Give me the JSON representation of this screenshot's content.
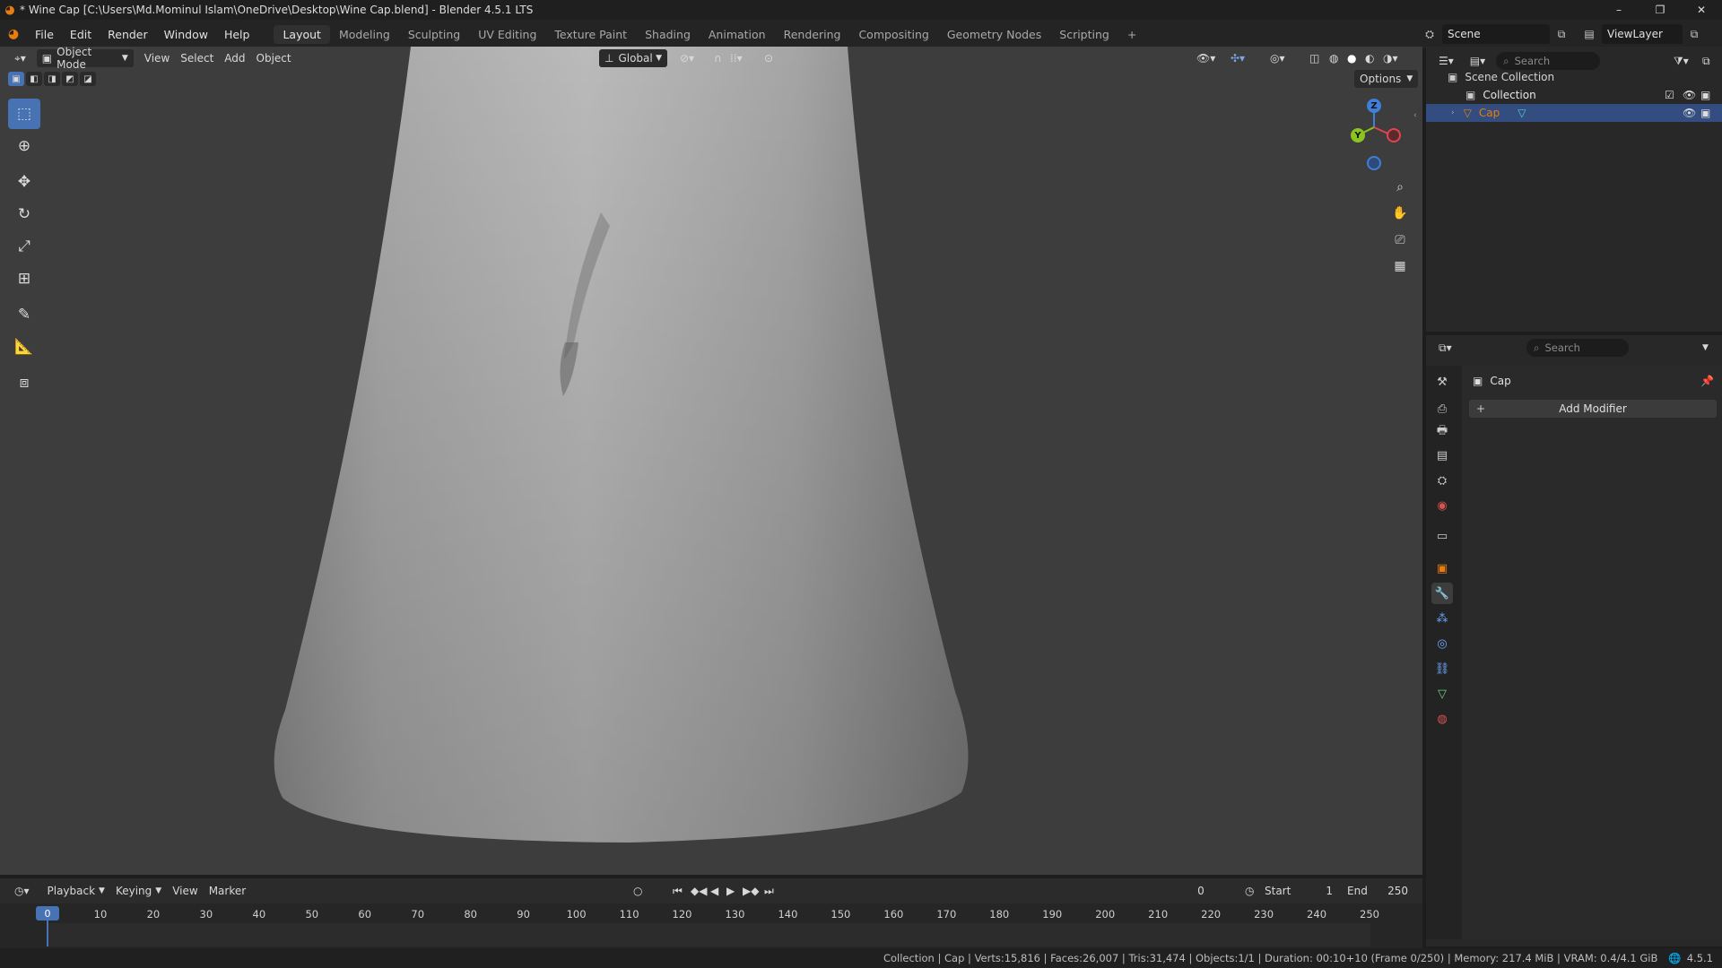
{
  "window": {
    "title": "* Wine Cap [C:\\Users\\Md.Mominul Islam\\OneDrive\\Desktop\\Wine Cap.blend] - Blender 4.5.1 LTS",
    "minimize": "–",
    "maximize": "❐",
    "close": "✕"
  },
  "menu": {
    "items": [
      "File",
      "Edit",
      "Render",
      "Window",
      "Help"
    ],
    "workspaces": [
      "Layout",
      "Modeling",
      "Sculpting",
      "UV Editing",
      "Texture Paint",
      "Shading",
      "Animation",
      "Rendering",
      "Compositing",
      "Geometry Nodes",
      "Scripting"
    ],
    "active_workspace": "Layout",
    "add_workspace": "+",
    "scene": "Scene",
    "view_layer": "ViewLayer"
  },
  "viewport": {
    "mode": "Object Mode",
    "menus": [
      "View",
      "Select",
      "Add",
      "Object"
    ],
    "transform_orientation": "Global",
    "options_label": "Options",
    "gizmo_axes": {
      "z": "Z",
      "y": "Y"
    }
  },
  "outliner": {
    "search_placeholder": "Search",
    "scene_collection": "Scene Collection",
    "collection": "Collection",
    "object": "Cap"
  },
  "properties": {
    "search_placeholder": "Search",
    "object_name": "Cap",
    "add_modifier": "Add Modifier"
  },
  "timeline": {
    "menus": [
      "Playback",
      "Keying",
      "View",
      "Marker"
    ],
    "current_frame": "0",
    "start_label": "Start",
    "start_value": "1",
    "end_label": "End",
    "end_value": "250",
    "ticks": [
      "0",
      "10",
      "20",
      "30",
      "40",
      "50",
      "60",
      "70",
      "80",
      "90",
      "100",
      "110",
      "120",
      "130",
      "140",
      "150",
      "160",
      "170",
      "180",
      "190",
      "200",
      "210",
      "220",
      "230",
      "240",
      "250"
    ]
  },
  "status": {
    "text": "Collection | Cap | Verts:15,816 | Faces:26,007 | Tris:31,474 | Objects:1/1 | Duration: 00:10+10 (Frame 0/250) | Memory: 217.4 MiB | VRAM: 0.4/4.1 GiB",
    "version": "4.5.1"
  },
  "colors": {
    "accent": "#4772b3",
    "selection": "#334d80",
    "axis_x": "#e0454f",
    "axis_y": "#8ac421",
    "axis_z": "#3f7ed9",
    "object_orange": "#e87d0d"
  }
}
